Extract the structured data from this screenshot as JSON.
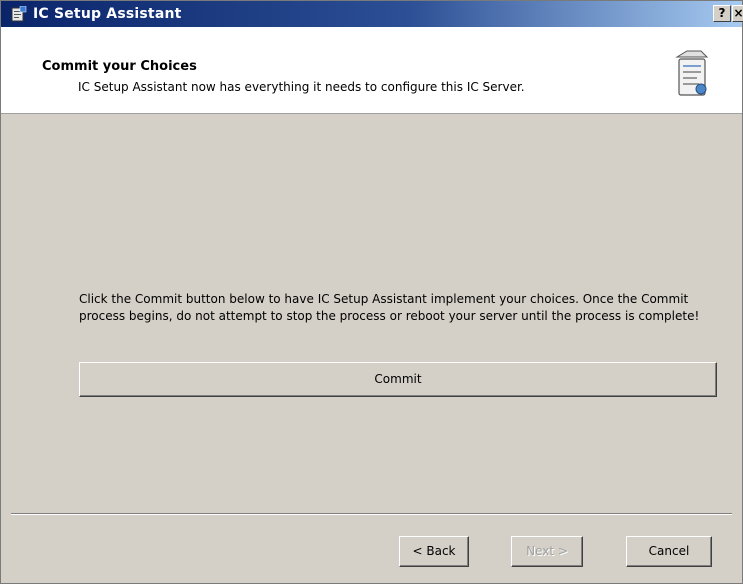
{
  "window": {
    "title": "IC Setup Assistant",
    "help_label": "?",
    "close_label": "×"
  },
  "header": {
    "heading": "Commit your Choices",
    "description": "IC Setup Assistant now has everything it needs to configure this IC Server."
  },
  "main": {
    "instructions": "Click the Commit button below to have IC Setup Assistant implement your choices. Once the Commit process begins, do not attempt to stop the process or reboot your server until the process is complete!",
    "commit_label": "Commit"
  },
  "footer": {
    "back_label": "< Back",
    "next_label": "Next >",
    "cancel_label": "Cancel"
  },
  "icons": {
    "app": "setup-assistant-icon",
    "header": "setup-wizard-icon"
  },
  "colors": {
    "titlebar_start": "#0a246a",
    "titlebar_end": "#a6caf0",
    "dialog_face": "#d4d0c8",
    "header_bg": "#ffffff",
    "disabled_text": "#a0a0a0"
  }
}
